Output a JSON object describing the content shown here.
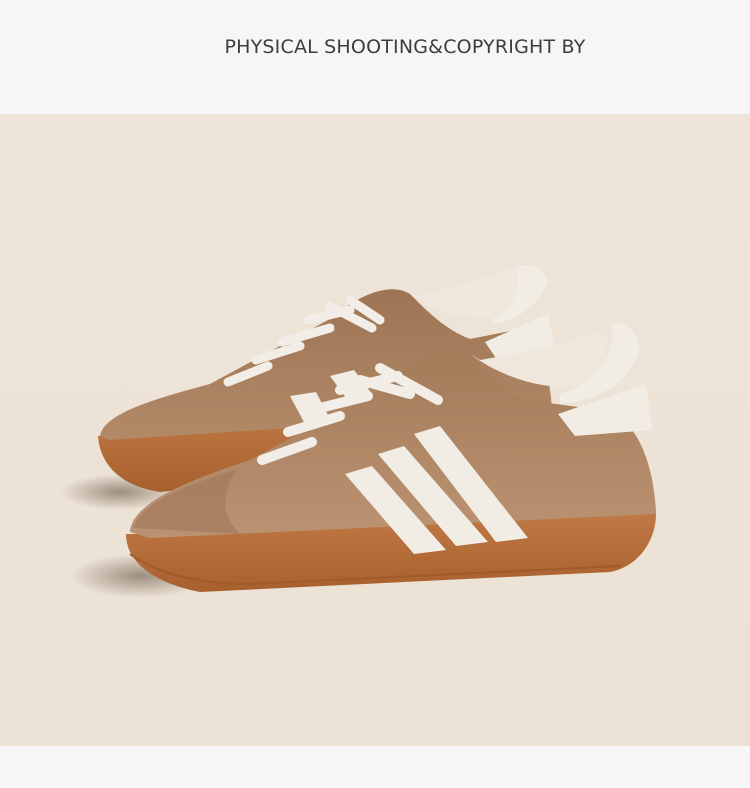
{
  "header": {
    "title": "PHYSICAL SHOOTING&COPYRIGHT BY"
  },
  "photo": {
    "subject": "pair-of-suede-sneakers",
    "colors": {
      "background": "#ede3d7",
      "suede": "#a97f5d",
      "suede_dark": "#8e6546",
      "sole": "#b56d3a",
      "stripes": "#f1ede4",
      "laces": "#f2eee7"
    }
  }
}
